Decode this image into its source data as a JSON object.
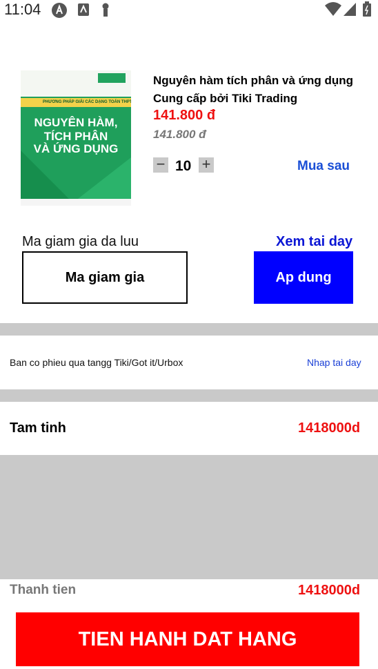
{
  "status_bar": {
    "time": "11:04"
  },
  "product": {
    "cover": {
      "strip_text": "PHƯƠNG PHÁP GIẢI CÁC DẠNG TOÁN THPT",
      "title_line1": "NGUYÊN HÀM,",
      "title_line2": "TÍCH PHÂN",
      "title_line3": "VÀ ỨNG DỤNG"
    },
    "title": "Nguyên hàm tích phân và ứng dụng",
    "seller": "Cung cấp bởi Tiki Trading",
    "price": "141.800 đ",
    "original_price": "141.800 đ",
    "minus": "−",
    "quantity": "10",
    "plus": "+",
    "buy_later": "Mua sau"
  },
  "coupon": {
    "saved_label": "Ma giam gia da luu",
    "see_here": "Xem tai day",
    "input_label": "Ma giam gia",
    "apply": "Ap dung"
  },
  "voucher": {
    "text": "Ban co phieu qua tangg Tiki/Got it/Urbox",
    "link": "Nhap tai day"
  },
  "summary": {
    "subtotal_label": "Tam tinh",
    "subtotal_value": "1418000d",
    "total_label": "Thanh tien",
    "total_value": "1418000d"
  },
  "checkout": {
    "button": "TIEN HANH DAT HANG"
  }
}
